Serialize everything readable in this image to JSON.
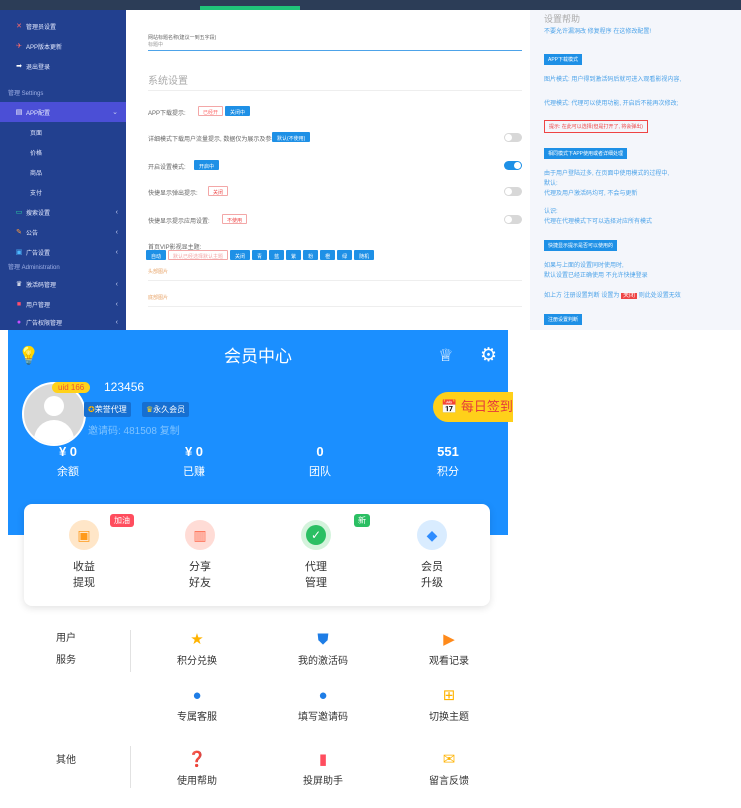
{
  "admin": {
    "sidebar": {
      "items": [
        {
          "icon": "✕",
          "label": "管理员设置"
        },
        {
          "icon": "✈",
          "label": "APP版本更新"
        },
        {
          "icon": "➡",
          "label": "退出登录"
        }
      ],
      "section_settings": "管理 Settings",
      "app_config": "APP配置",
      "sub": [
        "页面",
        "价格",
        "商品",
        "支付"
      ],
      "more": [
        {
          "icon": "▭",
          "label": "搜索设置"
        },
        {
          "icon": "✎",
          "label": "公告"
        },
        {
          "icon": "▣",
          "label": "广告设置"
        }
      ],
      "section_admin": "管理 Administration",
      "admin_items": [
        {
          "icon": "♛",
          "label": "激活码管理"
        },
        {
          "icon": "■",
          "label": "用户管理"
        },
        {
          "icon": "●",
          "label": "广告权限管理"
        }
      ]
    },
    "main": {
      "field_label": "网站标题名称(建议一到五字段)",
      "field_value": "标题中",
      "section_title": "系统设置",
      "rows": [
        {
          "label": "APP下载提示:",
          "opts": [
            "已经开",
            "关闭中"
          ]
        },
        {
          "label": "详细模式下载用户流量提示, 数据仅为展示及参考使用:",
          "opts": [
            "默认(不使用)"
          ]
        },
        {
          "label": "开启设置模式:",
          "opts": [
            "开启中"
          ]
        },
        {
          "label": "快捷显示弹出提示:",
          "opts": [
            "关闭"
          ]
        },
        {
          "label": "快捷显示提示应用设置:",
          "opts": [
            "不使用"
          ]
        },
        {
          "label": "首页VIP影视显主题:",
          "opts": [
            "自动",
            "默认已经选择默认主题",
            "关闭",
            "青",
            "蓝",
            "紫",
            "粉",
            "橙",
            "绿",
            "随机"
          ]
        }
      ],
      "links": [
        "头部图片",
        "底部图片"
      ]
    },
    "help": {
      "title": "设置帮助",
      "subtitle": "不要允许漏洞改 修复程序 在这修改配置!",
      "btn1": "APP下载模式",
      "lines1": [
        "图片模式: 用户得到激活码后就可进入观看影视内容,",
        "代理模式: 代理可以使用功能, 开启后不能再次修改;"
      ],
      "warn1": "提示: 在此可以选择(但是打开了, 将会弹出)",
      "btn2": "相同模式下APP使用或者详细处理",
      "lines2": [
        "由于用户登陆过多, 在页面中使用模式的过程中,",
        "默认:",
        "代理及用户激活码均可, 不会与更新"
      ],
      "label_default": "认识:",
      "line_default": "代理在代理模式下可以选择对应所有模式",
      "btn3": "快捷显示提示是否可以使用的",
      "lines3": [
        "如果与上面的设置同时使用时,",
        "默认设置已经正确使用 不允许快捷登录"
      ],
      "line4_pre": "如上方 注册设置判断 设置为",
      "line4_tag": "关闭",
      "line4_post": "则此处设置无效",
      "btn4": "注册设置判断"
    }
  },
  "app": {
    "title": "会员中心",
    "uid": "uid 166",
    "username": "123456",
    "badges": [
      "荣誉代理",
      "永久会员"
    ],
    "invite": "邀请码: 481508 复制",
    "checkin": "每日签到",
    "stats": [
      {
        "value": "¥ 0",
        "label": "余额"
      },
      {
        "value": "¥ 0",
        "label": "已赚"
      },
      {
        "value": "0",
        "label": "团队"
      },
      {
        "value": "551",
        "label": "积分"
      }
    ],
    "quick": [
      {
        "l1": "收益",
        "l2": "提现",
        "tag": "加油"
      },
      {
        "l1": "分享",
        "l2": "好友",
        "tag": ""
      },
      {
        "l1": "代理",
        "l2": "管理",
        "tag": "新"
      },
      {
        "l1": "会员",
        "l2": "升级",
        "tag": ""
      }
    ],
    "group_user_l1": "用户",
    "group_user_l2": "服务",
    "group_other": "其他",
    "services": [
      "积分兑换",
      "我的激活码",
      "观看记录",
      "专属客服",
      "填写邀请码",
      "切换主题"
    ],
    "others": [
      "使用帮助",
      "投屏助手",
      "留言反馈"
    ]
  }
}
